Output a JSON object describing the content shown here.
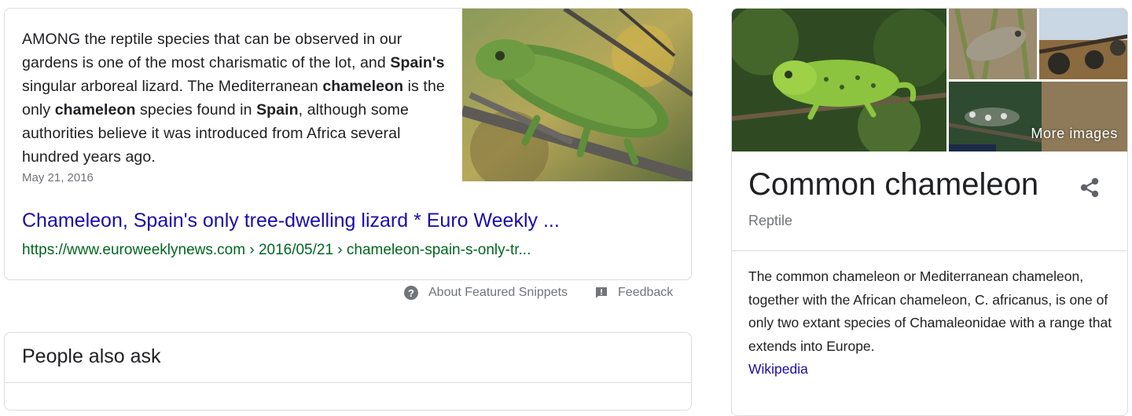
{
  "snippet": {
    "segments": [
      {
        "text": "AMONG the reptile species that can be observed in our gardens is one of the most charismatic of the lot, and ",
        "bold": false
      },
      {
        "text": "Spain's",
        "bold": true
      },
      {
        "text": " singular arboreal lizard. The Mediterranean ",
        "bold": false
      },
      {
        "text": "chameleon",
        "bold": true
      },
      {
        "text": " is the only ",
        "bold": false
      },
      {
        "text": "chameleon",
        "bold": true
      },
      {
        "text": " species found in ",
        "bold": false
      },
      {
        "text": "Spain",
        "bold": true
      },
      {
        "text": ", although some authorities believe it was introduced from Africa several hundred years ago.",
        "bold": false
      }
    ],
    "date": "May 21, 2016",
    "result_title": "Chameleon, Spain's only tree-dwelling lizard * Euro Weekly ...",
    "result_url": "https://www.euroweeklynews.com › 2016/05/21 › chameleon-spain-s-only-tr..."
  },
  "footer": {
    "about_label": "About Featured Snippets",
    "feedback_label": "Feedback"
  },
  "people_also_ask": {
    "title": "People also ask"
  },
  "knowledge_panel": {
    "more_images_label": "More images",
    "title": "Common chameleon",
    "subtitle": "Reptile",
    "description": "The common chameleon or Mediterranean chameleon, together with the African chameleon, C. africanus, is one of only two extant species of Chamaleonidae with a range that extends into Europe.",
    "source_link": "Wikipedia"
  },
  "colors": {
    "link": "#1a0dab",
    "url_green": "#006621",
    "muted": "#70757a",
    "border": "#dadce0"
  }
}
